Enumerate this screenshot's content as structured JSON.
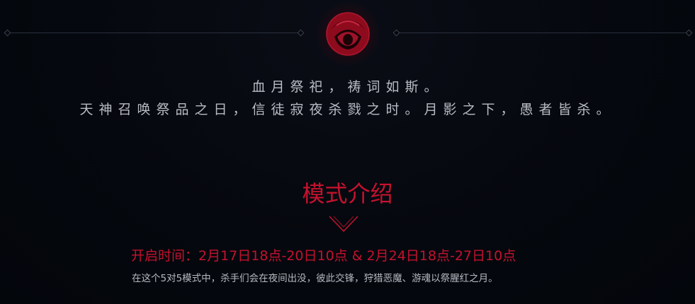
{
  "poem": {
    "line1": "血月祭祀，祷词如斯。",
    "line2": "天神召唤祭品之日，信徒寂夜杀戮之时。月影之下，愚者皆杀。"
  },
  "section": {
    "title": "模式介绍",
    "schedule": "开启时间：2月17日18点-20日10点 & 2月24日18点-27日10点",
    "description": "在这个5对5模式中，杀手们会在夜间出没，彼此交锋，狩猎恶魔、游魂以祭腥红之月。"
  },
  "colors": {
    "accent": "#c4122e",
    "background": "#04070d",
    "text": "#b9bcc4"
  },
  "icons": {
    "emblem": "blood-moon-emblem-icon"
  }
}
